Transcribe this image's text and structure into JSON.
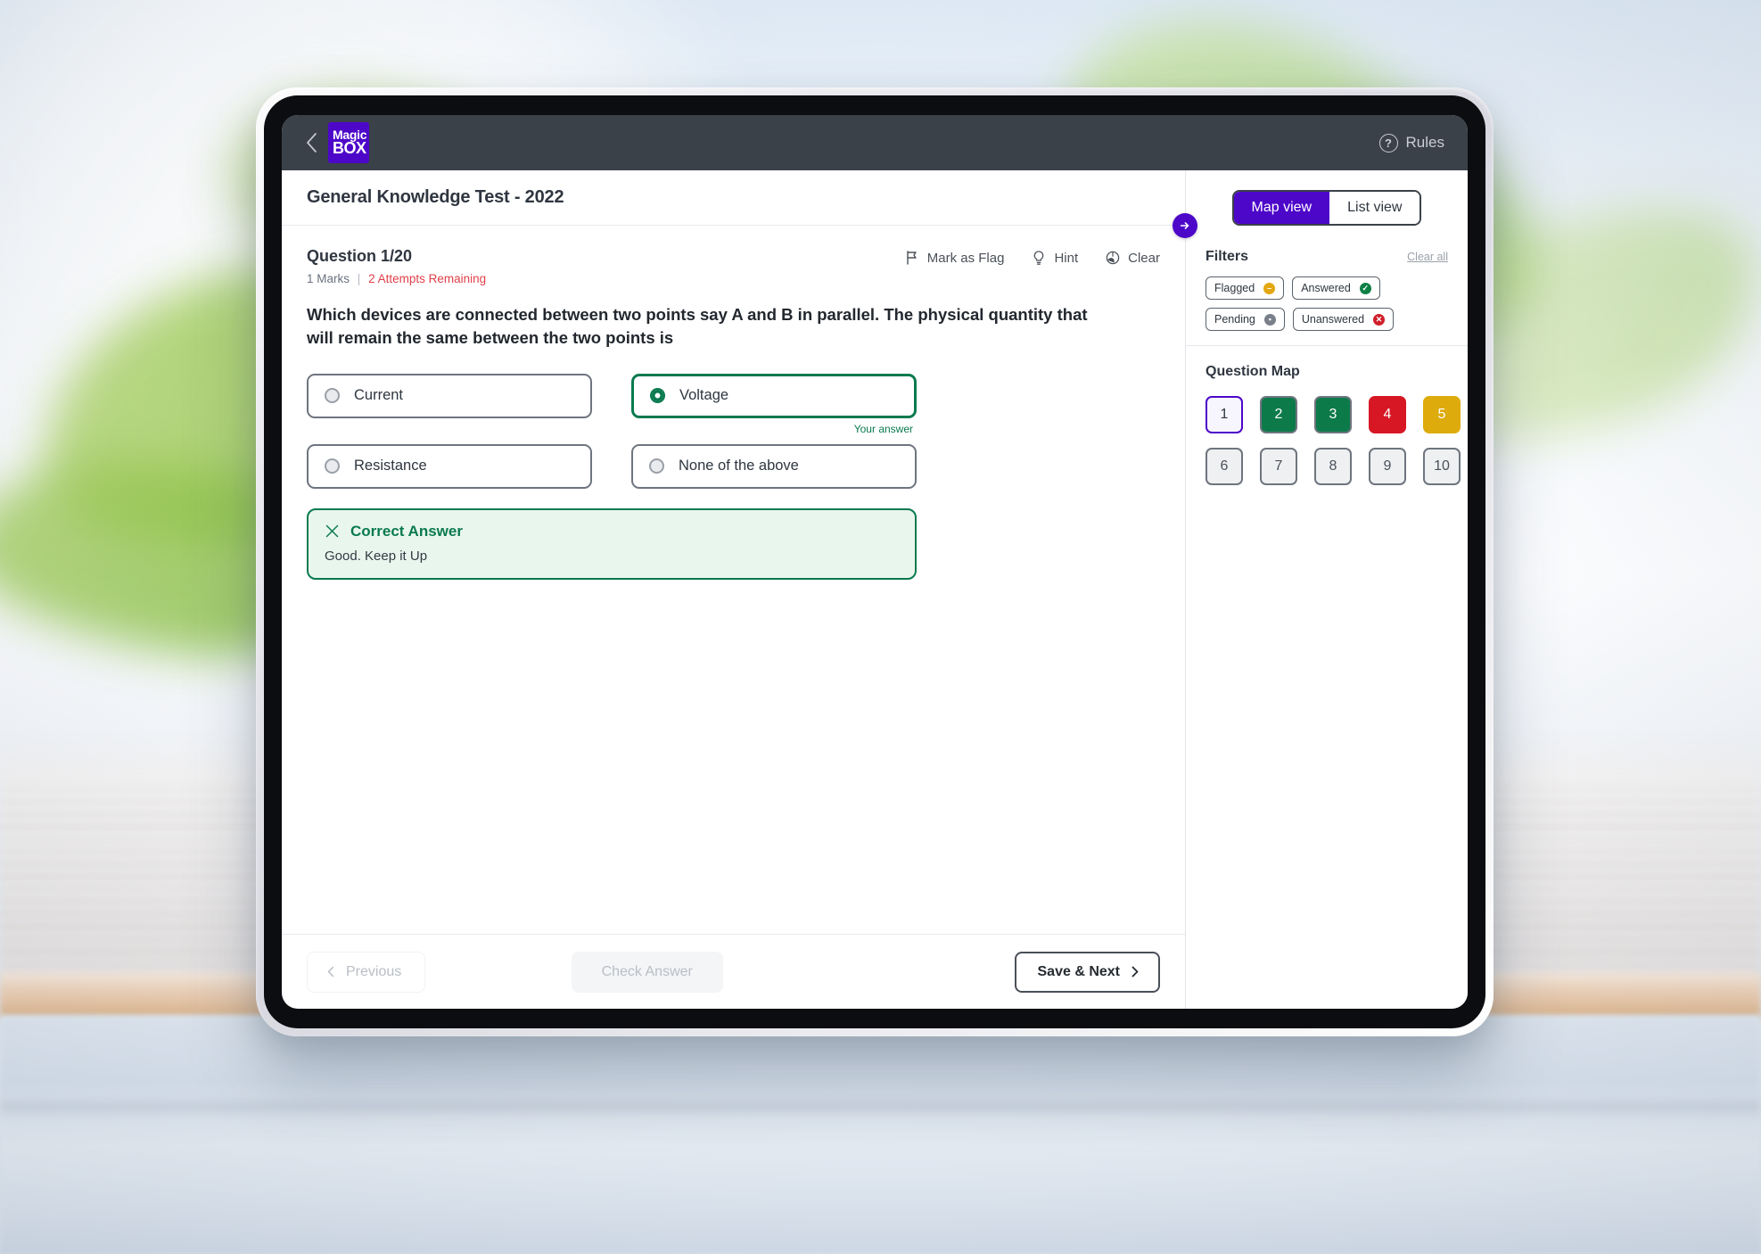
{
  "appbar": {
    "back_icon": "chevron-left-icon",
    "logo_line1": "Magic",
    "logo_line2": "BOX",
    "rules_label": "Rules",
    "rules_icon": "question-circle-icon"
  },
  "header": {
    "test_title": "General Knowledge Test - 2022",
    "collapse_icon": "arrow-right-circle-icon"
  },
  "question": {
    "number_label": "Question 1/20",
    "marks": "1 Marks",
    "separator": "|",
    "attempts": "2 Attempts Remaining",
    "text": "Which devices are connected between two points say A and B in parallel. The physical quantity that will remain the same between the two points is",
    "actions": [
      {
        "label": "Mark as Flag",
        "icon": "flag-icon"
      },
      {
        "label": "Hint",
        "icon": "lightbulb-icon"
      },
      {
        "label": "Clear",
        "icon": "eraser-icon"
      }
    ],
    "options": [
      {
        "label": "Current",
        "selected": false
      },
      {
        "label": "Voltage",
        "selected": true
      },
      {
        "label": "Resistance",
        "selected": false
      },
      {
        "label": "None of the above",
        "selected": false
      }
    ],
    "your_answer_label": "Your answer",
    "feedback": {
      "title": "Correct Answer",
      "icon": "close-x-icon",
      "body": "Good. Keep it Up"
    }
  },
  "footer": {
    "previous_label": "Previous",
    "previous_icon": "chevron-left-icon",
    "check_label": "Check Answer",
    "next_label": "Save & Next",
    "next_icon": "chevron-right-icon"
  },
  "sidebar": {
    "view_tabs": [
      {
        "label": "Map view",
        "active": true
      },
      {
        "label": "List view",
        "active": false
      }
    ],
    "filters_title": "Filters",
    "clear_all_label": "Clear all",
    "chips": [
      {
        "label": "Flagged",
        "badge": "flag",
        "glyph": "–"
      },
      {
        "label": "Answered",
        "badge": "check",
        "glyph": "✓"
      },
      {
        "label": "Pending",
        "badge": "pending",
        "glyph": "▪"
      },
      {
        "label": "Unanswered",
        "badge": "cross",
        "glyph": "✕"
      }
    ],
    "question_map_title": "Question Map",
    "tiles": [
      {
        "n": "1",
        "state": "current"
      },
      {
        "n": "2",
        "state": "answered"
      },
      {
        "n": "3",
        "state": "answered"
      },
      {
        "n": "4",
        "state": "wrong"
      },
      {
        "n": "5",
        "state": "flagged"
      },
      {
        "n": "6",
        "state": "none"
      },
      {
        "n": "7",
        "state": "none"
      },
      {
        "n": "8",
        "state": "none"
      },
      {
        "n": "9",
        "state": "none"
      },
      {
        "n": "10",
        "state": "none"
      }
    ]
  },
  "colors": {
    "brand_purple": "#4d07c9",
    "header_dark": "#3b4149",
    "correct_green": "#0a7a4f",
    "error_red": "#d71724",
    "flag_amber": "#deab0c"
  }
}
